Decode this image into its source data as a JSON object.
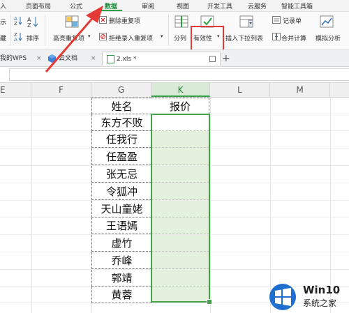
{
  "menu": {
    "items": [
      "入",
      "页面布局",
      "公式",
      "数据",
      "审阅",
      "视图",
      "开发工具",
      "云服务",
      "智能工具箱"
    ],
    "active": "数据"
  },
  "ribbon": {
    "sort_label": "排序",
    "show_label": "示",
    "hide_label": "藏",
    "highlight_duplicates": "高亮重复项",
    "delete_duplicates": "删除重复项",
    "reject_duplicates": "拒绝录入重复项",
    "split_label": "分列",
    "validity_label": "有效性",
    "insert_dropdown": "插入下拉列表",
    "record_sheet": "记录单",
    "merge_calc": "合并计算",
    "simulate": "模拟分析"
  },
  "tabs": {
    "tab1": "我的WPS",
    "tab2": "云文档",
    "tab3": "2.xls *",
    "add": "+"
  },
  "sheet": {
    "columns": [
      "E",
      "F",
      "G",
      "K",
      "L",
      "M"
    ],
    "selected_column": "K",
    "header_g": "姓名",
    "header_k": "报价",
    "names": [
      "东方不败",
      "任我行",
      "任盈盈",
      "张无忌",
      "令狐冲",
      "天山童姥",
      "王语嫣",
      "虚竹",
      "乔峰",
      "郭靖",
      "黄蓉"
    ]
  },
  "watermark": {
    "line1": "Win10",
    "line2": "系统之家"
  },
  "colors": {
    "accent": "#2da245",
    "highlight_red": "#e53935",
    "selection_fill": "#e3f1dc"
  }
}
